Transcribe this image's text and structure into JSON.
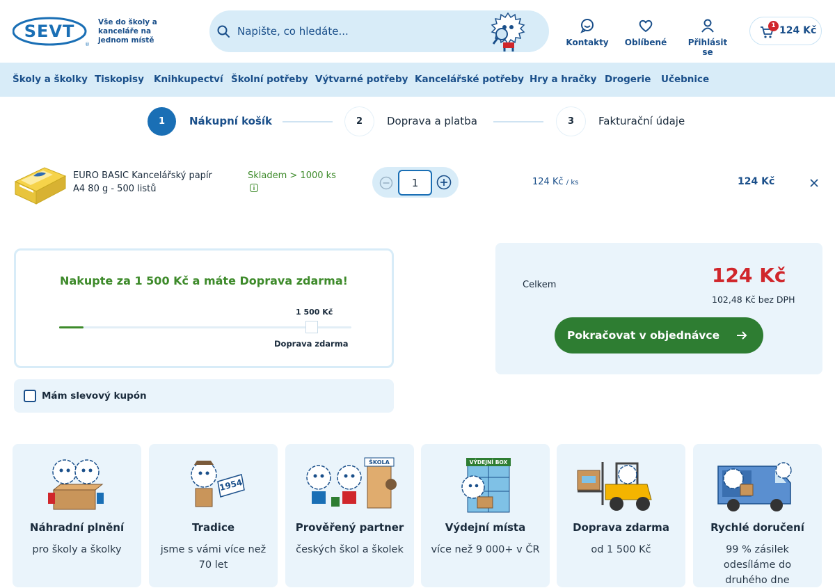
{
  "header": {
    "logo_text": "SEVT",
    "tagline": "Vše do školy a kanceláře na jednom místě",
    "search_placeholder": "Napište, co hledáte...",
    "links": [
      {
        "label": "Kontakty",
        "icon": "chat-smile-icon"
      },
      {
        "label": "Oblíbené",
        "icon": "heart-icon"
      },
      {
        "label": "Přihlásit se",
        "icon": "user-icon"
      }
    ],
    "cart": {
      "count": "1",
      "total": "124 Kč",
      "icon": "cart-icon"
    }
  },
  "nav": {
    "items": [
      "Školy a školky",
      "Tiskopisy",
      "Knihkupectví",
      "Školní potřeby",
      "Výtvarné potřeby",
      "Kancelářské potřeby",
      "Hry a hračky",
      "Drogerie",
      "Učebnice"
    ]
  },
  "steps": [
    {
      "number": "1",
      "label": "Nákupní košík",
      "active": true
    },
    {
      "number": "2",
      "label": "Doprava a platba",
      "active": false
    },
    {
      "number": "3",
      "label": "Fakturační údaje",
      "active": false
    }
  ],
  "cart_item": {
    "name": "EURO BASIC Kancelářský papír A4 80 g - 500 listů",
    "stock": "Skladem > 1000 ks",
    "quantity": "1",
    "unit_price": "124 Kč",
    "unit_suffix": "/ ks",
    "line_total": "124 Kč"
  },
  "free_shipping": {
    "message": "Nakupte za 1 500 Kč a máte Doprava zdarma!",
    "threshold": "1 500 Kč",
    "label": "Doprava zdarma",
    "progress_fraction": 0.083
  },
  "coupon": {
    "label": "Mám slevový kupón",
    "checked": false
  },
  "summary": {
    "label": "Celkem",
    "total": "124 Kč",
    "without_vat": "102,48 Kč bez DPH",
    "continue_label": "Pokračovat v objednávce"
  },
  "benefits": [
    {
      "title": "Náhradní plnění",
      "subtitle": "pro školy a školky"
    },
    {
      "title": "Tradice",
      "subtitle": "jsme s vámi více než 70 let",
      "art_text": "1954"
    },
    {
      "title": "Prověřený partner",
      "subtitle": "českých škol a školek",
      "art_text": "ŠKOLA"
    },
    {
      "title": "Výdejní místa",
      "subtitle": "více než 9 000+ v ČR",
      "art_text": "VÝDEJNÍ BOX"
    },
    {
      "title": "Doprava zdarma",
      "subtitle": "od 1 500 Kč"
    },
    {
      "title": "Rychlé doručení",
      "subtitle": "99 % zásilek odesíláme do druhého dne"
    }
  ],
  "colors": {
    "brand_blue": "#1a4f8a",
    "accent_blue": "#1a6fb5",
    "light_blue": "#d8ecf8",
    "green": "#2e7d32",
    "price_red": "#d0262b"
  }
}
